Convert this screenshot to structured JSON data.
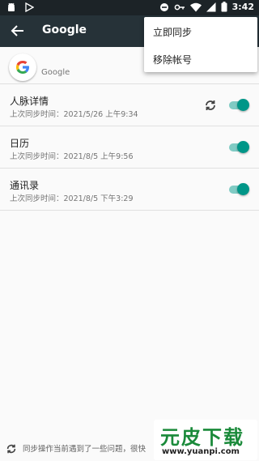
{
  "status_bar": {
    "time": "3:42",
    "icons": [
      "android-icon",
      "play-store-icon",
      "do-not-disturb-icon",
      "vpn-key-icon",
      "wifi-icon",
      "signal-icon",
      "battery-icon"
    ]
  },
  "app_bar": {
    "title": "Google",
    "back_icon": "arrow-back-icon"
  },
  "account": {
    "name": "Google",
    "logo_icon": "google-g-logo"
  },
  "sync_items": [
    {
      "name": "人脉详情",
      "last_sync": "上次同步时间：2021/5/26 上午9:34",
      "syncing": true,
      "enabled": true
    },
    {
      "name": "日历",
      "last_sync": "上次同步时间：2021/8/5 上午9:56",
      "syncing": false,
      "enabled": true
    },
    {
      "name": "通讯录",
      "last_sync": "上次同步时间：2021/8/5 下午3:29",
      "syncing": false,
      "enabled": true
    }
  ],
  "menu": {
    "items": [
      "立即同步",
      "移除帐号"
    ]
  },
  "footer": {
    "message": "同步操作当前遇到了一些问题，很快"
  },
  "watermark": {
    "title": "元皮下载",
    "url": "www.yuanpi.com"
  },
  "colors": {
    "status_bar": "#1c2327",
    "app_bar": "#263238",
    "accent": "#009688",
    "accent_light": "#80cbc4",
    "background": "#fafafa"
  }
}
